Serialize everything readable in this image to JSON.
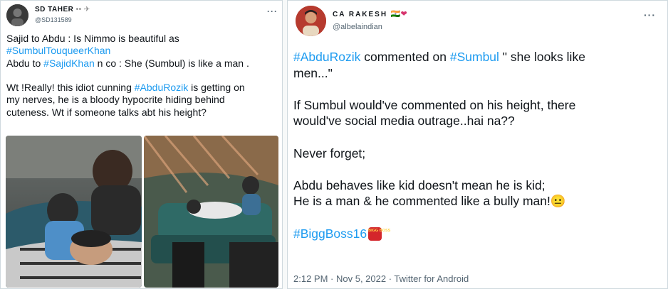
{
  "left_tweet": {
    "display_name": "SD TAHER",
    "name_emoji": "•• ✈",
    "handle": "@SD131589",
    "more_label": "···",
    "lines": [
      {
        "text": "Sajid to Abdu : Is Nimmo is beautiful as"
      },
      {
        "tag": "#SumbulTouqueerKhan"
      },
      {
        "pre": "Abdu to ",
        "tag": "#SajidKhan",
        "post": " n co : She (Sumbul) is like a man  ."
      },
      {
        "text": ""
      },
      {
        "pre": "Wt !Really! this idiot cunning ",
        "tag": "#AbduRozik",
        "post": " is getting on"
      },
      {
        "text": "my nerves, he is a bloody hypocrite hiding behind"
      },
      {
        "text": "cuteness. Wt if someone talks abt his height?"
      }
    ]
  },
  "right_tweet": {
    "display_name": "CA RAKESH",
    "name_emoji": "🇮🇳❤",
    "handle": "@albelaindian",
    "more_label": "···",
    "lines": [
      {
        "tag": "#AbduRozik",
        "post": " commented on "
      },
      {
        "text": "men...\""
      },
      {
        "text": ""
      },
      {
        "text": "If Sumbul would've commented on his height, there"
      },
      {
        "text": "would've social media outrage..hai na??"
      },
      {
        "text": ""
      },
      {
        "text": "Never forget;"
      },
      {
        "text": ""
      },
      {
        "text": "Abdu behaves like kid doesn't mean he is kid;"
      },
      {
        "text": "He is a man & he commented like a bully man!😐"
      },
      {
        "text": ""
      },
      {
        "tag": "#BiggBoss16"
      }
    ],
    "inline_tag": "#Sumbul",
    "inline_post": " \" she looks like",
    "badge": "BIGG BOSS",
    "time": "2:12 PM",
    "date": "Nov 5, 2022",
    "source": "Twitter for Android",
    "sep": " · "
  },
  "colors": {
    "link": "#1d9bf0",
    "muted": "#536471",
    "border": "#cfd9de"
  }
}
